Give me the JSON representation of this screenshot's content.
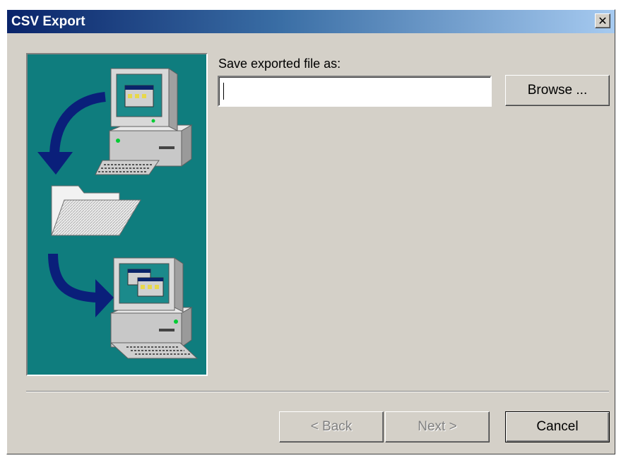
{
  "window": {
    "title": "CSV Export",
    "close_glyph": "✕",
    "colors": {
      "title_gradient_start": "#0a246a",
      "title_gradient_end": "#a6caf0",
      "face": "#d4d0c8",
      "illustration_bg": "#0f7d7e"
    }
  },
  "illustration": {
    "icons": [
      "computer-icon",
      "arrow-icon",
      "folder-icon",
      "arrow-icon",
      "computer-icon"
    ]
  },
  "form": {
    "save_label": "Save exported file as:",
    "file_value": "",
    "browse_label": "Browse ..."
  },
  "buttons": {
    "back": "< Back",
    "next": "Next >",
    "cancel": "Cancel"
  }
}
